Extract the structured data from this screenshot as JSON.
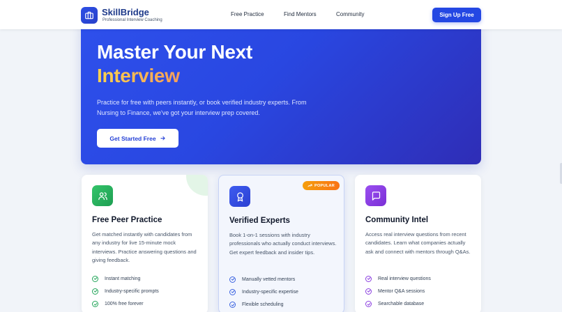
{
  "header": {
    "brand_name": "SkillBridge",
    "brand_tagline": "Professional Interview Coaching",
    "nav": [
      "Free Practice",
      "Find Mentors",
      "Community"
    ],
    "signup_label": "Sign Up Free"
  },
  "hero": {
    "title_line1": "Master Your Next",
    "title_line2": "Interview",
    "description": "Practice for free with peers instantly, or book verified industry experts. From Nursing to Finance, we've got your interview prep covered.",
    "cta_label": "Get Started Free",
    "cta_icon": "arrow-right-icon"
  },
  "cards": [
    {
      "icon": "users-icon",
      "icon_color": "#22a559",
      "title": "Free Peer Practice",
      "description": "Get matched instantly with candidates from any industry for live 15-minute mock interviews. Practice answering questions and giving feedback.",
      "features": [
        "Instant matching",
        "Industry-specific prompts",
        "100% free forever"
      ],
      "check_color": "#22a559"
    },
    {
      "icon": "award-icon",
      "icon_color": "#3650e3",
      "badge": "POPULAR",
      "title": "Verified Experts",
      "description": "Book 1-on-1 sessions with industry professionals who actually conduct interviews. Get expert feedback and insider tips.",
      "features": [
        "Manually vetted mentors",
        "Industry-specific expertise",
        "Flexible scheduling"
      ],
      "check_color": "#3b63e0"
    },
    {
      "icon": "message-square-icon",
      "icon_color": "#8b3fe0",
      "title": "Community Intel",
      "description": "Access real interview questions from recent candidates. Learn what companies actually ask and connect with mentors through Q&As.",
      "features": [
        "Real interview questions",
        "Mentor Q&A sessions",
        "Searchable database"
      ],
      "check_color": "#8b3fe0"
    }
  ],
  "colors": {
    "brand_primary": "#2447e3",
    "hero_gradient_start": "#2e50ec",
    "hero_gradient_end": "#2f2db6",
    "accent_gold": "#fcd34d",
    "badge_orange": "#f59e0b"
  }
}
